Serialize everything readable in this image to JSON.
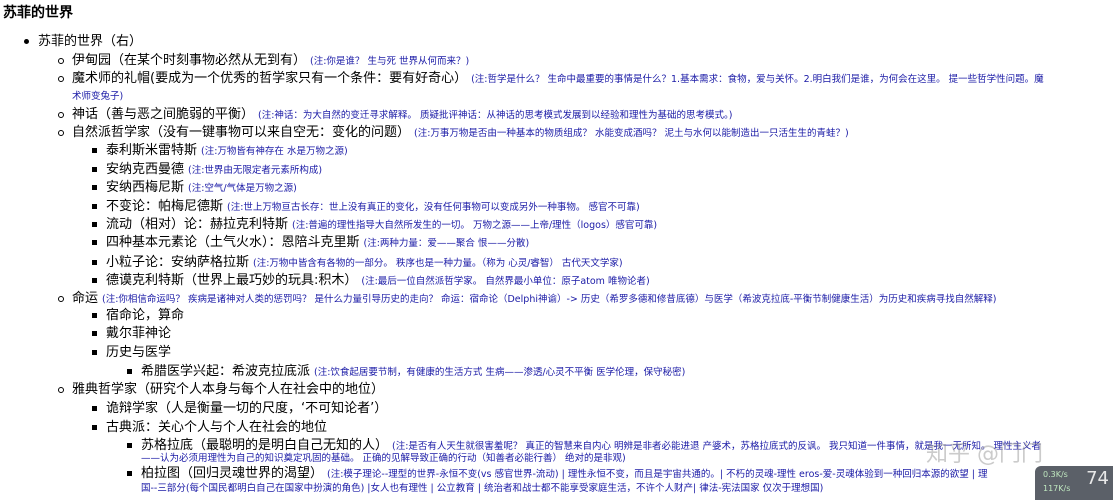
{
  "title": "苏菲的世界",
  "items": [
    {
      "level": 1,
      "main": "苏菲的世界（右）",
      "note": ""
    },
    {
      "level": 2,
      "main": "伊甸园（在某个时刻事物必然从无到有）",
      "note": "(注:你是谁？ 生与死 世界从何而来？)"
    },
    {
      "level": 2,
      "main": "魔术师的礼帽(要成为一个优秀的哲学家只有一个条件：要有好奇心）",
      "note": "(注:哲学是什么？ 生命中最重要的事情是什么？1.基本需求：食物，爱与关怀。2.明白我们是谁，为何会在这里。 提一些哲学性问题。魔"
    },
    {
      "level": 2,
      "main": "神话（善与恶之间脆弱的平衡）",
      "note": "(注:神话：为大自然的变迁寻求解释。 质疑批评神话：从神话的思考模式发展到以经验和理性为基础的思考模式。)"
    },
    {
      "level": 2,
      "main": "自然派哲学家（没有一键事物可以来自空无：变化的问题）",
      "note": "(注:万事万物是否由一种基本的物质组成？ 水能变成酒吗？ 泥土与水何以能制造出一只活生生的青蛙？)"
    },
    {
      "level": 3,
      "main": "泰利斯米雷特斯",
      "note": "(注:万物皆有神存在 水是万物之源)"
    },
    {
      "level": 3,
      "main": "安纳克西曼德",
      "note": "(注:世界由无限定者元素所构成)"
    },
    {
      "level": 3,
      "main": "安纳西梅尼斯",
      "note": "(注:空气/气体是万物之源)"
    },
    {
      "level": 3,
      "main": "不变论：帕梅尼德斯",
      "note": "(注:世上万物亘古长存：世上没有真正的变化，没有任何事物可以变成另外一种事物。 感官不可靠)"
    },
    {
      "level": 3,
      "main": "流动（相对）论：赫拉克利特斯",
      "note": "(注:普遍的理性指导大自然所发生的一切。 万物之源——上帝/理性（logos）感官可靠)"
    },
    {
      "level": 3,
      "main": "四种基本元素论（土气火水）：恩陪斗克里斯",
      "note": "(注:两种力量：爱——聚合 恨——分散)"
    },
    {
      "level": 3,
      "main": "小粒子论：安纳萨格拉斯",
      "note": "(注:万物中皆含有各物的一部分。 秩序也是一种力量。（称为 心灵/睿智） 古代天文学家)"
    },
    {
      "level": 3,
      "main": "德谟克利特斯（世界上最巧妙的玩具:积木）",
      "note": "(注:最后一位自然派哲学家。 自然界最小单位：原子atom 唯物论者)"
    },
    {
      "level": 2,
      "main": "命运",
      "note": "(注:你相信命运吗？ 疾病是诸神对人类的惩罚吗？ 是什么力量引导历史的走向？ 命运：宿命论（Delphi神谕）-> 历史（希罗多德和修昔底德）与医学（希波克拉底-平衡节制健康生活）为历史和疾病寻找自然解释)"
    },
    {
      "level": 3,
      "main": "宿命论，算命",
      "note": ""
    },
    {
      "level": 3,
      "main": "戴尔菲神论",
      "note": ""
    },
    {
      "level": 3,
      "main": "历史与医学",
      "note": ""
    },
    {
      "level": 4,
      "main": "希腊医学兴起：希波克拉底派",
      "note": "(注:饮食起居要节制，有健康的生活方式 生病——渗透/心灵不平衡 医学伦理，保守秘密)"
    },
    {
      "level": 2,
      "main": "雅典哲学家（研究个人本身与每个人在社会中的地位）",
      "note": ""
    },
    {
      "level": 3,
      "main": "诡辩学家（人是衡量一切的尺度，‘不可知论者’）",
      "note": ""
    },
    {
      "level": 3,
      "main": "古典派：关心个人与个人在社会的地位",
      "note": ""
    },
    {
      "level": 4,
      "main": "苏格拉底（最聪明的是明白自己无知的人）",
      "note": "(注:是否有人天生就很害羞呢？ 真正的智慧来自内心 明辨是非者必能进退 产婆术，苏格拉底式的反讽。 我只知道一件事情，就是我一无所知。 理性主义者"
    },
    {
      "level": 4,
      "main": "柏拉图（回归灵魂世界的渴望）",
      "note": "(注:模子理论--理型的世界-永恒不变(vs 感官世界-流动) | 理性永恒不变，而且是宇宙共通的。| 不朽的灵魂-理性 eros-爱-灵魂体验到一种回归本源的欲望 | 理"
    }
  ],
  "wraps": [
    {
      "text": "术师变兔子)"
    },
    {
      "text": "——认为必须用理性为自己的知识奠定巩固的基础。 正确的见解导致正确的行动（知善者必能行善） 绝对的是非观)"
    },
    {
      "text": "国--三部分(每个国民都明白自己在国家中扮演的角色) |女人也有理性 | 公立教育 | 统治者和战士都不能享受家庭生活，不许个人财产| 律法-宪法国家 仅次于理想国)"
    }
  ],
  "watermark": "知乎 @门门",
  "system_badge": {
    "number": "74",
    "upload": "0.3K/s",
    "download": "117K/s"
  }
}
